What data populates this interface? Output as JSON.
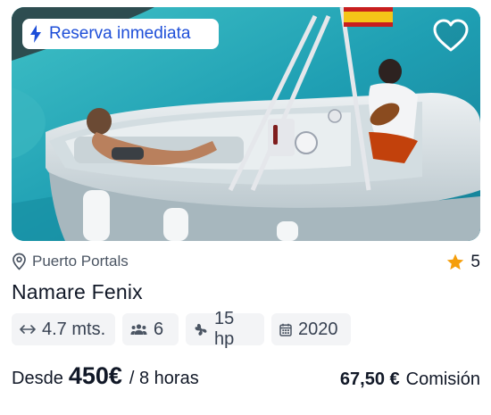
{
  "listing": {
    "badge": {
      "label": "Reserva inmediata",
      "icon": "bolt-icon",
      "color": "#1d4ed8"
    },
    "favorite": {
      "icon": "heart-outline-icon",
      "active": false
    },
    "location": {
      "icon": "map-pin-icon",
      "label": "Puerto Portals"
    },
    "rating": {
      "icon": "star-icon",
      "value": "5",
      "color": "#f59e0b"
    },
    "title": "Namare Fenix",
    "specs": [
      {
        "icon": "length-arrows-icon",
        "label": "4.7 mts."
      },
      {
        "icon": "people-icon",
        "label": "6"
      },
      {
        "icon": "propeller-icon",
        "label": "15 hp"
      },
      {
        "icon": "calendar-icon",
        "label": "2020"
      }
    ],
    "price": {
      "prefix": "Desde",
      "amount": "450€",
      "per": "/ 8 horas"
    },
    "commission": {
      "amount": "67,50 €",
      "label": "Comisión"
    }
  }
}
